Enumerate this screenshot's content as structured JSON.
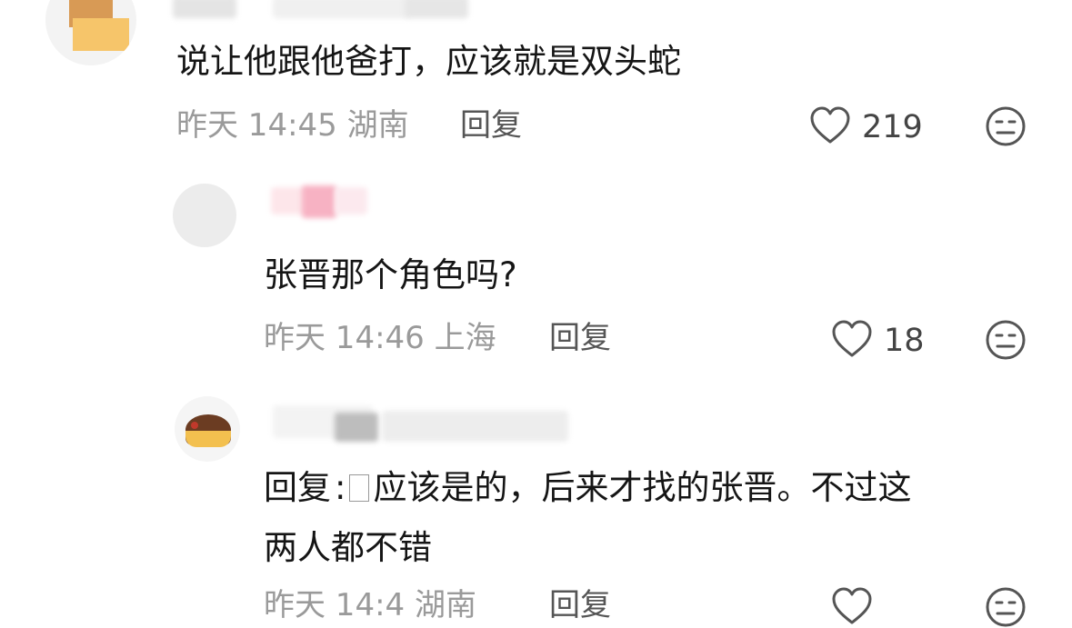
{
  "comments": [
    {
      "text": "说让他跟他爸打，应该就是双头蛇",
      "date": "昨天 14:45",
      "location": "湖南",
      "reply_label": "回复",
      "likes": "219"
    },
    {
      "text": "张晋那个角色吗?",
      "date": "昨天 14:46",
      "location": "上海",
      "reply_label": "回复",
      "likes": "18"
    },
    {
      "reply_prefix": "回复",
      "separator": ":",
      "text_line1": "应该是的，后来才找的张晋。不过这",
      "text_line2": "两人都不错",
      "date": "昨天 14:4",
      "location": "湖南",
      "reply_label": "回复"
    }
  ],
  "colors": {
    "text": "#151515",
    "meta": "#9a9a9a",
    "icon": "#555555"
  },
  "icons": [
    "heart-icon",
    "meh-face-icon"
  ]
}
